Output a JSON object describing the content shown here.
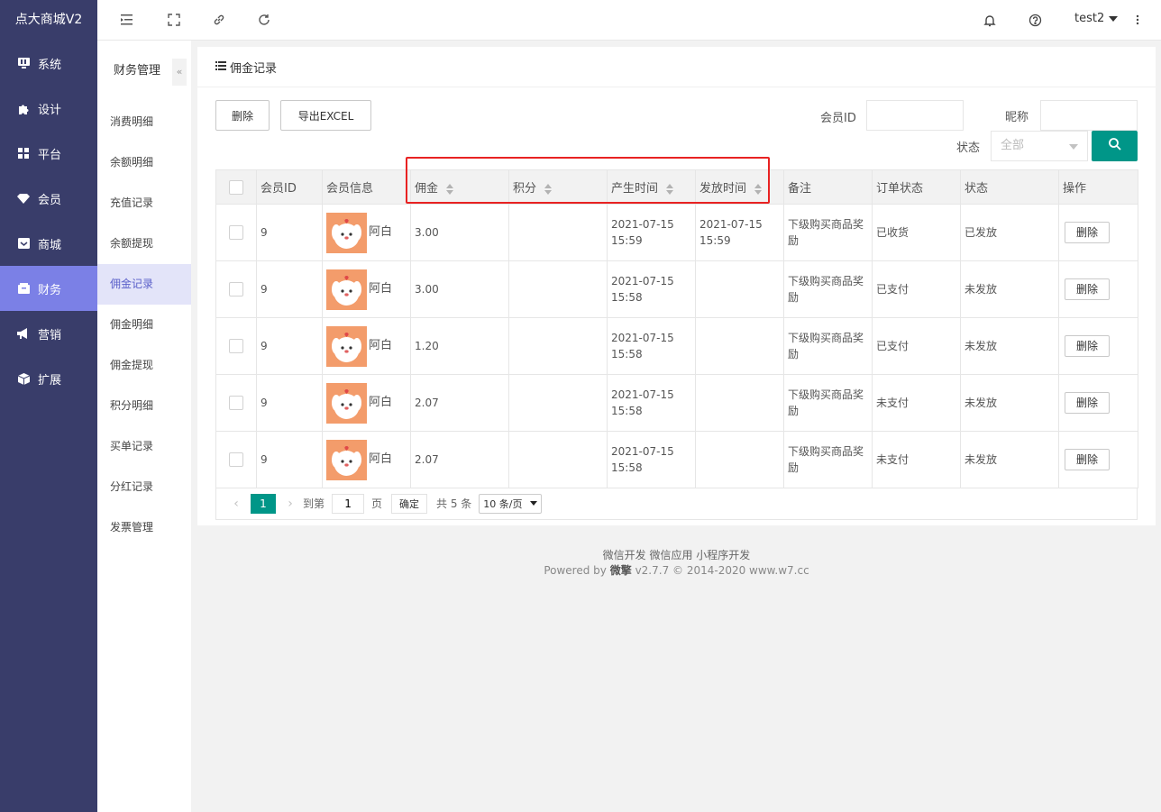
{
  "brand": "点大商城V2",
  "sidebar": {
    "items": [
      {
        "label": "系统",
        "icon": "monitor-icon"
      },
      {
        "label": "设计",
        "icon": "puzzle-icon"
      },
      {
        "label": "平台",
        "icon": "grid-icon"
      },
      {
        "label": "会员",
        "icon": "diamond-icon"
      },
      {
        "label": "商城",
        "icon": "inbox-icon"
      },
      {
        "label": "财务",
        "icon": "wallet-icon",
        "active": true
      },
      {
        "label": "营销",
        "icon": "megaphone-icon"
      },
      {
        "label": "扩展",
        "icon": "cube-icon"
      }
    ]
  },
  "header": {
    "icons": [
      "menu-collapse-icon",
      "fullscreen-icon",
      "link-icon",
      "refresh-icon",
      "bell-icon",
      "help-icon",
      "more-vertical-icon"
    ],
    "user": "test2"
  },
  "submenu": {
    "title": "财务管理",
    "collapse_label": "«",
    "items": [
      "消费明细",
      "余额明细",
      "充值记录",
      "余额提现",
      "佣金记录",
      "佣金明细",
      "佣金提现",
      "积分明细",
      "买单记录",
      "分红记录",
      "发票管理"
    ],
    "active_index": 4
  },
  "card": {
    "title": "佣金记录",
    "delete_btn": "删除",
    "export_btn": "导出EXCEL",
    "filters": {
      "member_id_label": "会员ID",
      "member_id_value": "",
      "nickname_label": "昵称",
      "nickname_value": "",
      "status_label": "状态",
      "status_value": "全部"
    }
  },
  "table": {
    "columns": [
      "会员ID",
      "会员信息",
      "佣金",
      "积分",
      "产生时间",
      "发放时间",
      "备注",
      "订单状态",
      "状态",
      "操作"
    ],
    "rows": [
      {
        "id": "9",
        "name": "阿白",
        "commission": "3.00",
        "points": "",
        "created": "2021-07-15 15:59",
        "issued": "2021-07-15 15:59",
        "remark": "下级购买商品奖励",
        "order_status": "已收货",
        "order_status_color": "green",
        "status": "已发放",
        "status_color": "green",
        "action": "删除"
      },
      {
        "id": "9",
        "name": "阿白",
        "commission": "3.00",
        "points": "",
        "created": "2021-07-15 15:58",
        "issued": "",
        "remark": "下级购买商品奖励",
        "order_status": "已支付",
        "order_status_color": "green",
        "status": "未发放",
        "status_color": "red",
        "action": "删除"
      },
      {
        "id": "9",
        "name": "阿白",
        "commission": "1.20",
        "points": "",
        "created": "2021-07-15 15:58",
        "issued": "",
        "remark": "下级购买商品奖励",
        "order_status": "已支付",
        "order_status_color": "green",
        "status": "未发放",
        "status_color": "red",
        "action": "删除"
      },
      {
        "id": "9",
        "name": "阿白",
        "commission": "2.07",
        "points": "",
        "created": "2021-07-15 15:58",
        "issued": "",
        "remark": "下级购买商品奖励",
        "order_status": "未支付",
        "order_status_color": "red",
        "status": "未发放",
        "status_color": "red",
        "action": "删除"
      },
      {
        "id": "9",
        "name": "阿白",
        "commission": "2.07",
        "points": "",
        "created": "2021-07-15 15:58",
        "issued": "",
        "remark": "下级购买商品奖励",
        "order_status": "未支付",
        "order_status_color": "red",
        "status": "未发放",
        "status_color": "red",
        "action": "删除"
      }
    ]
  },
  "pagination": {
    "current": "1",
    "goto_label": "到第",
    "goto_value": "1",
    "page_label": "页",
    "confirm": "确定",
    "total": "共 5 条",
    "page_size": "10 条/页"
  },
  "footer": {
    "line1": "微信开发 微信应用 小程序开发",
    "powered": "Powered by",
    "brand": "微擎",
    "version": "v2.7.7 © 2014-2020 www.w7.cc"
  },
  "colors": {
    "sidebar_bg": "#393D6A",
    "active_nav": "#7B80E6",
    "accent": "#009688",
    "success": "#2C8F2C",
    "danger": "#E02020",
    "highlight_box": "#E82222"
  }
}
